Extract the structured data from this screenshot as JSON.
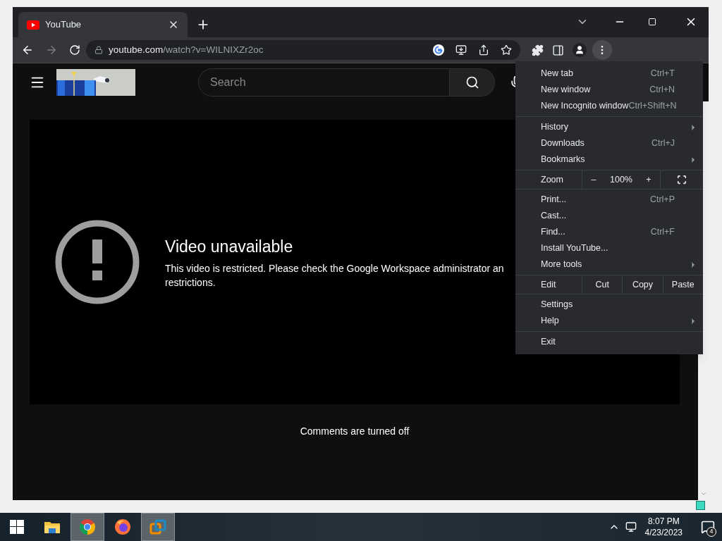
{
  "browser": {
    "tab": {
      "title": "YouTube",
      "selected": true
    },
    "address": {
      "host": "youtube.com",
      "path": "/watch?v=WILNIXZr2oc"
    },
    "forward_disabled": true
  },
  "youtube": {
    "search": {
      "placeholder": "Search"
    },
    "error": {
      "title": "Video unavailable",
      "lines": [
        "This video is restricted. Please check the Google Workspace administrator an",
        "restrictions."
      ]
    },
    "comments": "Comments are turned off"
  },
  "menu": {
    "sections": [
      [
        {
          "kind": "item",
          "label": "New tab",
          "shortcut": "Ctrl+T",
          "submenu": false
        },
        {
          "kind": "item",
          "label": "New window",
          "shortcut": "Ctrl+N",
          "submenu": false
        },
        {
          "kind": "item",
          "label": "New Incognito window",
          "shortcut": "Ctrl+Shift+N",
          "submenu": false
        }
      ],
      [
        {
          "kind": "item",
          "label": "History",
          "submenu": true
        },
        {
          "kind": "item",
          "label": "Downloads",
          "shortcut": "Ctrl+J",
          "submenu": false
        },
        {
          "kind": "item",
          "label": "Bookmarks",
          "submenu": true
        }
      ],
      [
        {
          "kind": "zoom",
          "label": "Zoom",
          "minus": "–",
          "value": "100%",
          "plus": "+"
        }
      ],
      [
        {
          "kind": "item",
          "label": "Print...",
          "shortcut": "Ctrl+P",
          "submenu": false
        },
        {
          "kind": "item",
          "label": "Cast...",
          "submenu": false
        },
        {
          "kind": "item",
          "label": "Find...",
          "shortcut": "Ctrl+F",
          "submenu": false
        },
        {
          "kind": "item",
          "label": "Install YouTube...",
          "submenu": false
        },
        {
          "kind": "item",
          "label": "More tools",
          "submenu": true
        }
      ],
      [
        {
          "kind": "edit",
          "label": "Edit",
          "actions": [
            "Cut",
            "Copy",
            "Paste"
          ]
        }
      ],
      [
        {
          "kind": "item",
          "label": "Settings",
          "submenu": false
        },
        {
          "kind": "item",
          "label": "Help",
          "submenu": true
        }
      ],
      [
        {
          "kind": "item",
          "label": "Exit",
          "submenu": false
        }
      ]
    ]
  },
  "taskbar": {
    "apps": [
      {
        "kind": "explorer",
        "selected": false
      },
      {
        "kind": "chrome",
        "selected": true
      },
      {
        "kind": "firefox",
        "selected": false
      },
      {
        "kind": "vmware",
        "selected": true
      }
    ],
    "time": "8:07 PM",
    "date": "4/23/2023",
    "notifications": "4"
  }
}
